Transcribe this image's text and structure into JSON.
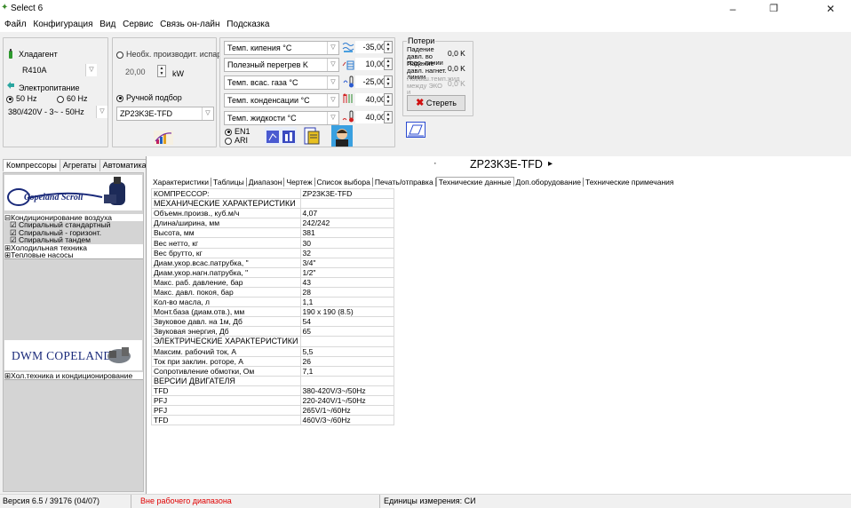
{
  "window": {
    "title": "Select 6",
    "controls": {
      "minimize": "–",
      "maximize": "❐",
      "close": "✕"
    }
  },
  "menu": [
    "Файл",
    "Конфигурация",
    "Вид",
    "Сервис",
    "Связь он-лайн",
    "Подсказка"
  ],
  "refrigerant": {
    "label": "Хладагент",
    "value": "R410A",
    "power_label": "Электропитание",
    "freq_50": "50 Hz",
    "freq_60": "60 Hz",
    "voltage": "380/420V - 3~ - 50Hz"
  },
  "capacity": {
    "required_label": "Необх. производит. испар",
    "value": "20,00",
    "unit": "kW",
    "manual_label": "Ручной подбор",
    "model": "ZP23K3E-TFD"
  },
  "temps": [
    {
      "label": "Темп. кипения °C",
      "value": "-35,00"
    },
    {
      "label": "Полезный перегрев K",
      "value": "10,00"
    },
    {
      "label": "Темп. всас. газа °C",
      "value": "-25,00"
    },
    {
      "label": "Темп. конденсации °C",
      "value": "40,00"
    },
    {
      "label": "Темп. жидкости °C",
      "value": "40,00"
    }
  ],
  "standard": {
    "en": "EN1",
    "ari": "ARI"
  },
  "losses": {
    "title": "Потери",
    "items": [
      {
        "label": "Падение давл. во всас. линии",
        "value": "0,0 K"
      },
      {
        "label": "Падение давл. нагнет. линии",
        "value": "0,0 K"
      },
      {
        "label": "Повыш.темп.жид между ЭКО и",
        "value": "0,0 K"
      }
    ],
    "clear_button": "Стереть"
  },
  "left_tabs": [
    "Компрессоры",
    "Агрегаты",
    "Автоматика"
  ],
  "brand1": "Copeland Scroll",
  "tree1": [
    {
      "text": "⊟Кондиционирование воздуха",
      "selected": true
    },
    {
      "text": "  ☑ Спиральный стандартный",
      "selected": false
    },
    {
      "text": "  ☑ Спиральный - горизонт.",
      "selected": false
    },
    {
      "text": "  ☑ Спиральный тандем",
      "selected": false
    },
    {
      "text": "⊞Холодильная техника",
      "selected": false
    },
    {
      "text": "⊞Тепловые насосы",
      "selected": false
    }
  ],
  "brand2": "DWM COPELAND",
  "tree2": [
    {
      "text": "⊞Хол.техника и кондиционирование",
      "selected": false
    }
  ],
  "main": {
    "dot": "·",
    "model_title": "ZP23K3E-TFD",
    "arrow": "▸",
    "tabs": [
      "Характеристики",
      "Таблицы",
      "Диапазон",
      "Чертеж",
      "Список выбора",
      "Печать/отправка",
      "Технические данные",
      "Доп.оборудование",
      "Технические примечания"
    ],
    "selected_tab": 6
  },
  "spec_rows": [
    {
      "k": "КОМПРЕССОР:",
      "v": "ZP23K3E-TFD",
      "hd": false
    },
    {
      "k": "МЕХАНИЧЕСКИЕ ХАРАКТЕРИСТИКИ",
      "v": "",
      "hd": true
    },
    {
      "k": "Объемн.произв., куб.м/ч",
      "v": "4,07",
      "hd": false
    },
    {
      "k": "Длина/ширина, мм",
      "v": "242/242",
      "hd": false
    },
    {
      "k": "Высота, мм",
      "v": "381",
      "hd": false
    },
    {
      "k": "Вес нетто, кг",
      "v": "30",
      "hd": false
    },
    {
      "k": "Вес брутто, кг",
      "v": "32",
      "hd": false
    },
    {
      "k": "Диам.укор.всас.патрубка, \"",
      "v": "3/4\"",
      "hd": false
    },
    {
      "k": "Диам.укор.нагн.патрубка, \"",
      "v": "1/2\"",
      "hd": false
    },
    {
      "k": "Макс. раб. давление, бар",
      "v": "43",
      "hd": false
    },
    {
      "k": "Макс. давл. покоя, бар",
      "v": "28",
      "hd": false
    },
    {
      "k": "Кол-во масла, л",
      "v": "1,1",
      "hd": false
    },
    {
      "k": "Монт.база (диам.отв.), мм",
      "v": "190 x 190 (8.5)",
      "hd": false
    },
    {
      "k": "Звуковое давл. на 1м, Дб",
      "v": "54",
      "hd": false
    },
    {
      "k": "Звуковая энергия, Дб",
      "v": "65",
      "hd": false
    },
    {
      "k": "ЭЛЕКТРИЧЕСКИЕ ХАРАКТЕРИСТИКИ",
      "v": "",
      "hd": true
    },
    {
      "k": "Максим. рабочий ток, А",
      "v": "5,5",
      "hd": false
    },
    {
      "k": "Ток при заклин. роторе, А",
      "v": "26",
      "hd": false
    },
    {
      "k": "Сопротивление обмотки, Ом",
      "v": "7,1",
      "hd": false
    },
    {
      "k": "ВЕРСИИ ДВИГАТЕЛЯ",
      "v": "",
      "hd": true
    },
    {
      "k": "TFD",
      "v": "380-420V/3~/50Hz",
      "hd": false
    },
    {
      "k": "PFJ",
      "v": "220-240V/1~/50Hz",
      "hd": false
    },
    {
      "k": "PFJ",
      "v": "265V/1~/60Hz",
      "hd": false
    },
    {
      "k": "TFD",
      "v": "460V/3~/60Hz",
      "hd": false
    }
  ],
  "status": {
    "version": "Версия 6.5  / 39176 (04/07)",
    "warning": "Вне рабочего диапазона",
    "units": "Единицы измерения: СИ",
    "warning_color": "#e00000"
  }
}
